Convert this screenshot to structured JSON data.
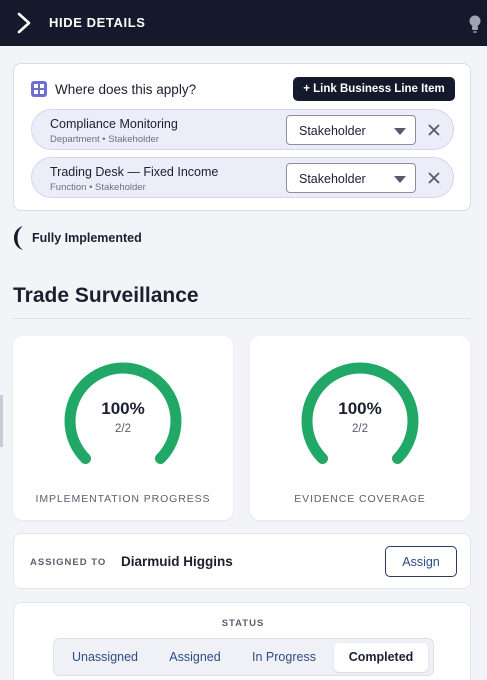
{
  "header": {
    "title": "HIDE DETAILS",
    "icons": [
      "chevron-right-icon",
      "lightbulb-icon"
    ]
  },
  "apply": {
    "question": "Where does this apply?",
    "link_button": "+ Link Business Line Item",
    "items": [
      {
        "name": "Compliance Monitoring",
        "meta": "Department • Stakeholder",
        "role": "Stakeholder"
      },
      {
        "name": "Trading Desk — Fixed Income",
        "meta": "Function • Stakeholder",
        "role": "Stakeholder"
      }
    ]
  },
  "implementation_status": "Fully Implemented",
  "section": {
    "title": "Trade Surveillance"
  },
  "gauges": [
    {
      "percent_label": "100%",
      "fraction": "2/2",
      "caption": "IMPLEMENTATION PROGRESS",
      "value": 1.0
    },
    {
      "percent_label": "100%",
      "fraction": "2/2",
      "caption": "EVIDENCE COVERAGE",
      "value": 1.0
    }
  ],
  "assignment": {
    "label": "ASSIGNED TO",
    "assignee": "Diarmuid Higgins",
    "button": "Assign"
  },
  "status": {
    "header": "STATUS",
    "options": [
      "Unassigned",
      "Assigned",
      "In Progress",
      "Completed"
    ],
    "selected": "Completed"
  },
  "colors": {
    "accent_dark": "#141a2c",
    "gauge_green": "#21a866",
    "link_blue": "#2c4c85",
    "pill_bg": "#ecedf9"
  }
}
